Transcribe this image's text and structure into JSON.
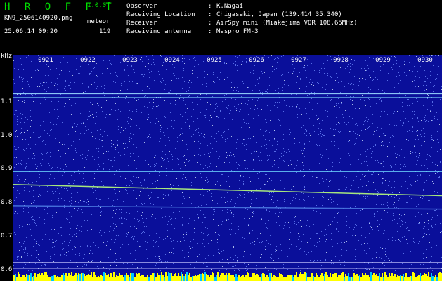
{
  "header": {
    "brand": "H R O F F T",
    "version": "1.0.0f",
    "filename": "KN9_2506140920.png",
    "datetime": "25.06.14 09:20",
    "meteor_label": "meteor",
    "meteor_count": "119"
  },
  "info": [
    {
      "key": "Observer",
      "value": "K.Nagai"
    },
    {
      "key": "Receiving Location",
      "value": "Chigasaki, Japan (139.414 35.340)"
    },
    {
      "key": "Receiver",
      "value": "AirSpy mini (Miakejima VOR 108.65MHz)"
    },
    {
      "key": "Receiving antenna",
      "value": "Maspro FM-3"
    }
  ],
  "spectrogram": {
    "unit_label": "kHz",
    "y_ticks": [
      "1.1",
      "1.0",
      "0.9",
      "0.8",
      "0.7",
      "0.6"
    ],
    "y_range": [
      0.595,
      1.24
    ],
    "time_ticks": [
      "0921",
      "0922",
      "0923",
      "0924",
      "0925",
      "0926",
      "0927",
      "0928",
      "0929",
      "0930"
    ],
    "traces": [
      {
        "from": 1.124,
        "to": 1.124,
        "color": "#9ad8ff"
      },
      {
        "from": 1.112,
        "to": 1.112,
        "color": "#7fe0ff"
      },
      {
        "from": 0.892,
        "to": 0.892,
        "color": "#6fd8ff"
      },
      {
        "from": 0.853,
        "to": 0.82,
        "color": "#b8ff7a"
      },
      {
        "from": 0.79,
        "to": 0.78,
        "color": "#4a78e0"
      },
      {
        "from": 0.62,
        "to": 0.62,
        "color": "#c8c8ff"
      },
      {
        "from": 0.604,
        "to": 0.604,
        "color": "#c8c8ff"
      }
    ],
    "colors": {
      "background": "#0a0f9a",
      "noise": "#6f8cff",
      "bottom_strip": "#ffff00",
      "bottom_strip_alt": "#00c8ff"
    }
  }
}
